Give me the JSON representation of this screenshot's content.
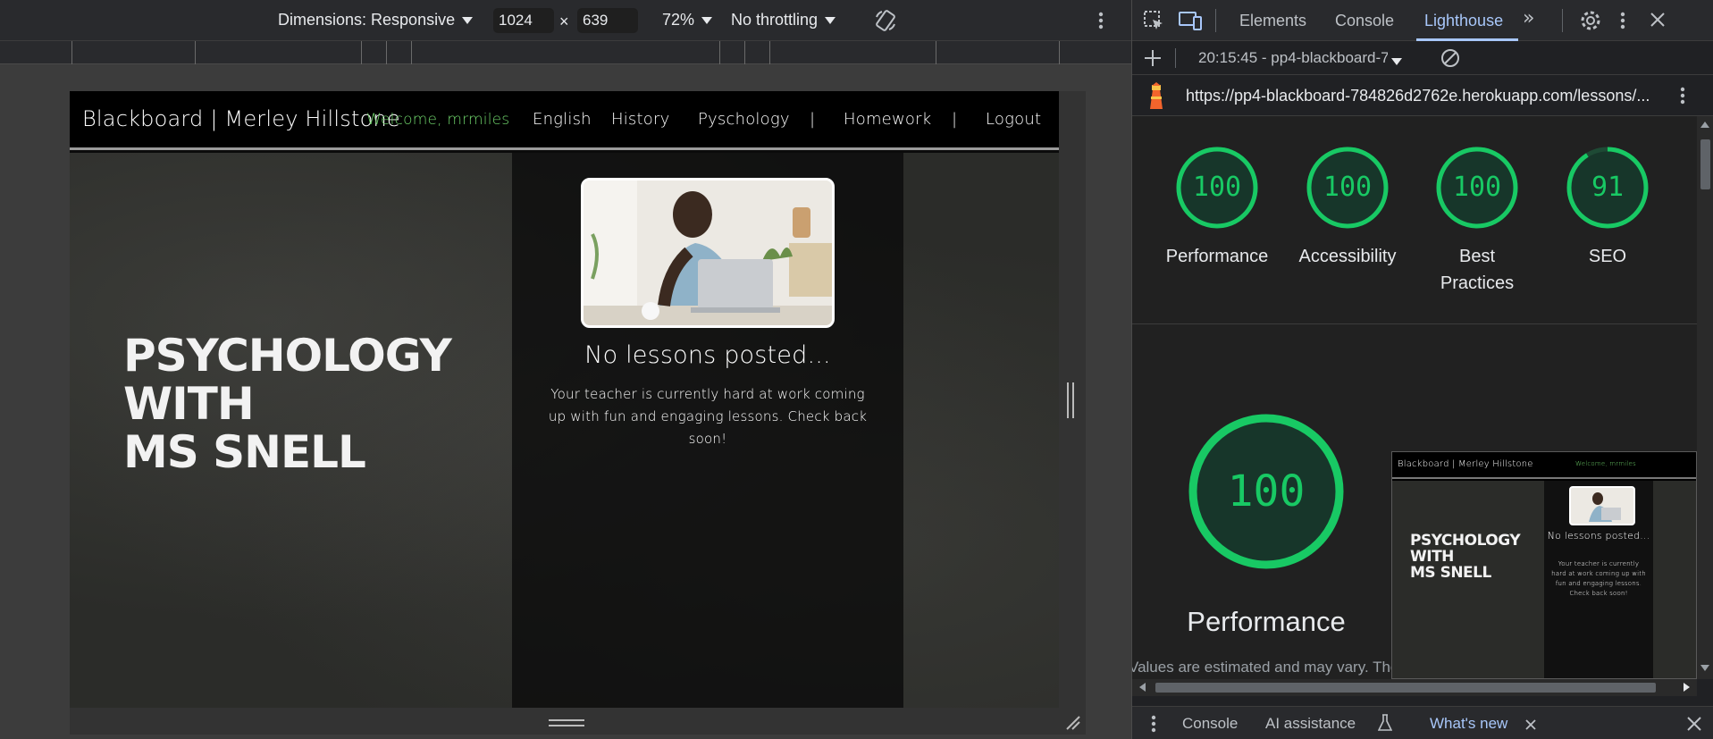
{
  "device_toolbar": {
    "dimensions_label": "Dimensions: Responsive",
    "width": "1024",
    "times": "×",
    "height": "639",
    "zoom": "72%",
    "throttling": "No throttling",
    "rotate_icon": "rotate-icon",
    "more_icon": "more-vert-icon"
  },
  "site": {
    "brand": "Blackboard | Merley Hillstone",
    "welcome": "Welcome, mrmiles",
    "nav": [
      "English",
      "History",
      "Pyschology",
      "|",
      "Homework",
      "|",
      "Logout"
    ],
    "board_title": [
      "Psychology",
      "with",
      "Ms Snell"
    ],
    "no_lessons": "No lessons posted...",
    "message": "Your teacher is currently hard at work coming up with fun and engaging lessons. Check back soon!"
  },
  "devtools": {
    "tabs": [
      "Elements",
      "Console",
      "Lighthouse"
    ],
    "active_tab": "Lighthouse",
    "report_selector": "20:15:45 - pp4-blackboard-7",
    "url": "https://pp4-blackboard-784826d2762e.herokuapp.com/lessons/...",
    "scores": [
      {
        "value": "100",
        "label": "Performance"
      },
      {
        "value": "100",
        "label": "Accessibility"
      },
      {
        "value": "100",
        "label": "Best Practices"
      },
      {
        "value": "91",
        "label": "SEO"
      }
    ],
    "main_score": "100",
    "main_label": "Performance",
    "estimate": "Values are estimated and may vary. The",
    "thumb": {
      "brand": "Blackboard | Merley Hillstone",
      "welcome": "Welcome, mrmiles",
      "title": [
        "Psychology",
        "with",
        "Ms Snell"
      ],
      "no_lessons": "No lessons posted...",
      "message": "Your teacher is currently hard at work coming up with fun and engaging lessons. Check back soon!"
    },
    "drawer": {
      "tabs": [
        "Console",
        "AI assistance",
        "What's new"
      ],
      "active": "What's new"
    }
  },
  "colors": {
    "score_green": "#18c964",
    "tab_active": "#a8c7fa",
    "welcome_green": "#6fd46b"
  }
}
